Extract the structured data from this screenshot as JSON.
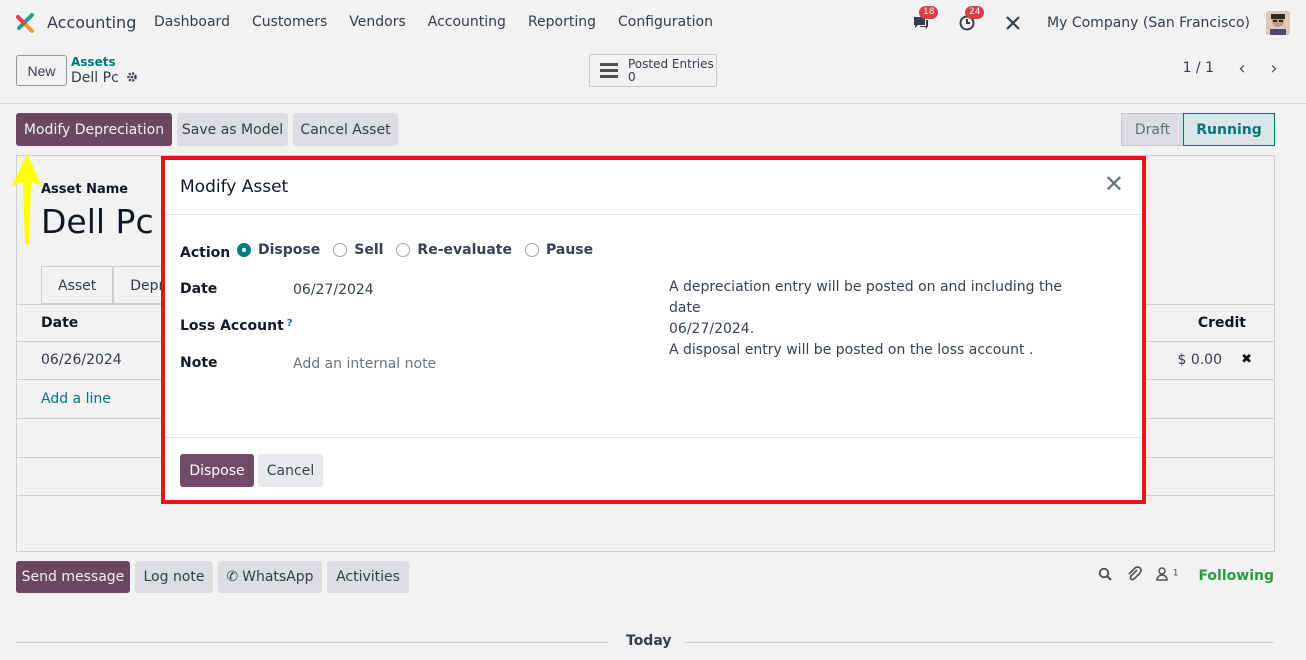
{
  "navbar": {
    "app_name": "Accounting",
    "menu": [
      "Dashboard",
      "Customers",
      "Vendors",
      "Accounting",
      "Reporting",
      "Configuration"
    ],
    "messages_count": "18",
    "activities_count": "24",
    "company": "My Company (San Francisco)"
  },
  "control_panel": {
    "new_label": "New",
    "breadcrumb": "Assets",
    "record_title": "Dell Pc",
    "smart_button": {
      "label": "Posted Entries",
      "value": "0"
    },
    "pager": "1 / 1"
  },
  "statusbar": {
    "buttons": [
      "Modify Depreciation",
      "Save as Model",
      "Cancel Asset"
    ],
    "stages": [
      "Draft",
      "Running"
    ],
    "active_stage": "Running"
  },
  "form": {
    "asset_name_label": "Asset Name",
    "asset_name": "Dell Pc",
    "tabs": [
      "Asset",
      "Depre"
    ],
    "table": {
      "headers": {
        "date": "Date",
        "credit": "Credit"
      },
      "rows": [
        {
          "date": "06/26/2024",
          "credit": "$ 0.00"
        }
      ],
      "add_line": "Add a line"
    }
  },
  "chatter": {
    "buttons": [
      "Send message",
      "Log note",
      "WhatsApp",
      "Activities"
    ],
    "followers_count": "1",
    "following_label": "Following",
    "today_label": "Today"
  },
  "modal": {
    "title": "Modify Asset",
    "action_label": "Action",
    "actions": [
      "Dispose",
      "Sell",
      "Re-evaluate",
      "Pause"
    ],
    "selected_action": "Dispose",
    "date_label": "Date",
    "date_value": "06/27/2024",
    "loss_account_label": "Loss Account",
    "loss_account_help": "?",
    "note_label": "Note",
    "note_placeholder": "Add an internal note",
    "info_line1": "A depreciation entry will be posted on and including the date",
    "info_line2": "06/27/2024.",
    "info_line3": "A disposal entry will be posted on the loss account .",
    "primary_button": "Dispose",
    "cancel_button": "Cancel"
  },
  "colors": {
    "primary": "#714b67",
    "accent": "#017e84",
    "highlight_border": "#e8141c",
    "annotation_arrow": "#ffff00"
  }
}
